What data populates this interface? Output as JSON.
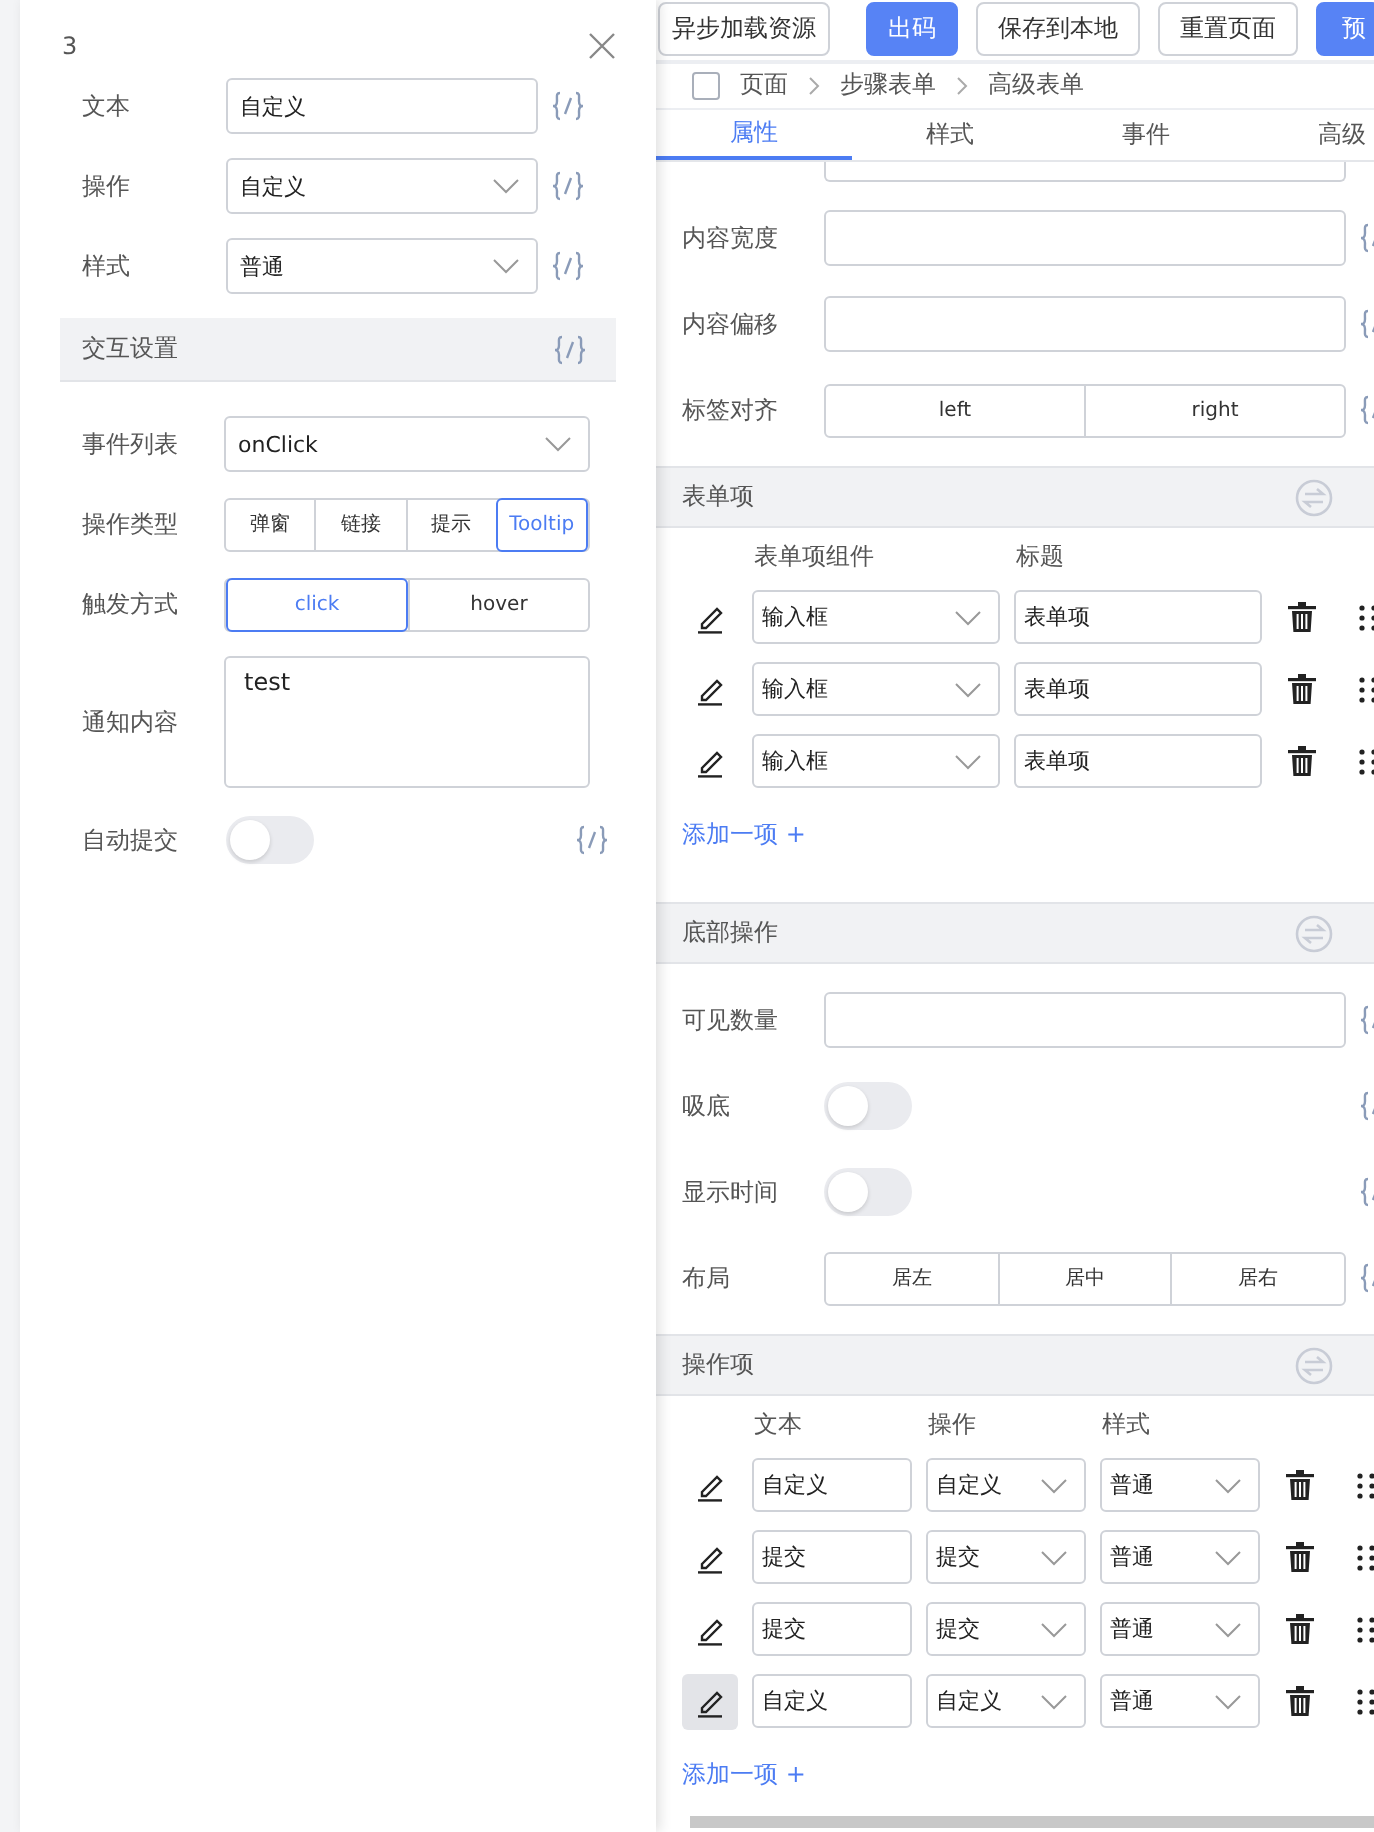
{
  "popover": {
    "title": "3",
    "fields": [
      {
        "kind": "input",
        "label": "文本",
        "value": "自定义",
        "binding": true
      },
      {
        "kind": "select",
        "label": "操作",
        "value": "自定义",
        "binding": true
      },
      {
        "kind": "select",
        "label": "样式",
        "value": "普通",
        "binding": true
      }
    ],
    "section": {
      "title": "交互设置",
      "binding": true
    },
    "interaction": [
      {
        "kind": "select",
        "label": "事件列表",
        "value": "onClick",
        "binding": false
      },
      {
        "kind": "segmented",
        "label": "操作类型",
        "binding": false,
        "options": [
          {
            "label": "弹窗",
            "selected": false
          },
          {
            "label": "链接",
            "selected": false
          },
          {
            "label": "提示",
            "selected": false
          },
          {
            "label": "Tooltip",
            "selected": true
          }
        ]
      },
      {
        "kind": "segmented",
        "label": "触发方式",
        "binding": false,
        "options": [
          {
            "label": "click",
            "selected": true
          },
          {
            "label": "hover",
            "selected": false
          }
        ]
      },
      {
        "kind": "textarea",
        "label": "通知内容",
        "value": "test",
        "binding": false
      },
      {
        "kind": "switch",
        "label": "自动提交",
        "on": false,
        "binding": true
      }
    ]
  },
  "toolbar": [
    {
      "label": "异步加载资源",
      "primary": false
    },
    {
      "label": "出码",
      "primary": true
    },
    {
      "label": "保存到本地",
      "primary": false
    },
    {
      "label": "重置页面",
      "primary": false
    },
    {
      "label": "预",
      "primary": true
    }
  ],
  "breadcrumb": [
    "页面",
    "步骤表单",
    "高级表单"
  ],
  "tabs": [
    {
      "label": "属性",
      "selected": true
    },
    {
      "label": "样式",
      "selected": false
    },
    {
      "label": "事件",
      "selected": false
    },
    {
      "label": "高级",
      "selected": false
    }
  ],
  "panel": [
    {
      "kind": "input",
      "label": "内容宽度",
      "binding": true
    },
    {
      "kind": "input",
      "label": "内容偏移",
      "binding": true
    },
    {
      "kind": "segmented",
      "label": "标签对齐",
      "binding": true,
      "options": [
        {
          "label": "left",
          "selected": false
        },
        {
          "label": "right",
          "selected": false
        }
      ]
    },
    {
      "kind": "header",
      "title": "表单项"
    },
    {
      "kind": "list",
      "columns": [
        "表单项组件",
        "标题"
      ],
      "add": "添加一项 +",
      "rows": [
        {
          "highlighted": false,
          "cells": [
            {
              "kind": "select",
              "value": "输入框"
            },
            {
              "kind": "input",
              "value": "表单项"
            }
          ]
        },
        {
          "highlighted": false,
          "cells": [
            {
              "kind": "select",
              "value": "输入框"
            },
            {
              "kind": "input",
              "value": "表单项"
            }
          ]
        },
        {
          "highlighted": false,
          "cells": [
            {
              "kind": "select",
              "value": "输入框"
            },
            {
              "kind": "input",
              "value": "表单项"
            }
          ]
        }
      ]
    },
    {
      "kind": "header",
      "title": "底部操作"
    },
    {
      "kind": "input",
      "label": "可见数量",
      "binding": true
    },
    {
      "kind": "switch",
      "label": "吸底",
      "on": false,
      "binding": true
    },
    {
      "kind": "switch",
      "label": "显示时间",
      "on": false,
      "binding": true
    },
    {
      "kind": "segmented",
      "label": "布局",
      "binding": true,
      "options": [
        {
          "label": "居左",
          "selected": false
        },
        {
          "label": "居中",
          "selected": false
        },
        {
          "label": "居右",
          "selected": false
        }
      ]
    },
    {
      "kind": "header",
      "title": "操作项"
    },
    {
      "kind": "list",
      "columns": [
        "文本",
        "操作",
        "样式"
      ],
      "add": "添加一项 +",
      "rows": [
        {
          "highlighted": false,
          "cells": [
            {
              "kind": "input",
              "value": "自定义"
            },
            {
              "kind": "select",
              "value": "自定义"
            },
            {
              "kind": "select",
              "value": "普通"
            }
          ]
        },
        {
          "highlighted": false,
          "cells": [
            {
              "kind": "input",
              "value": "提交"
            },
            {
              "kind": "select",
              "value": "提交"
            },
            {
              "kind": "select",
              "value": "普通"
            }
          ]
        },
        {
          "highlighted": false,
          "cells": [
            {
              "kind": "input",
              "value": "提交"
            },
            {
              "kind": "select",
              "value": "提交"
            },
            {
              "kind": "select",
              "value": "普通"
            }
          ]
        },
        {
          "highlighted": true,
          "cells": [
            {
              "kind": "input",
              "value": "自定义"
            },
            {
              "kind": "select",
              "value": "自定义"
            },
            {
              "kind": "select",
              "value": "普通"
            }
          ]
        }
      ]
    }
  ]
}
